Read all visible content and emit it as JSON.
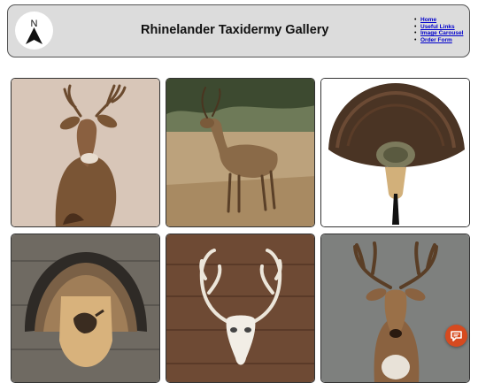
{
  "header": {
    "logo_letter": "N",
    "title": "Rhinelander Taxidermy Gallery",
    "nav": [
      {
        "label": "Home"
      },
      {
        "label": "Useful Links"
      },
      {
        "label": "Image Carousel"
      },
      {
        "label": "Order Form"
      }
    ]
  },
  "gallery": {
    "tiles": [
      {
        "subject": "whitetail deer shoulder mount"
      },
      {
        "subject": "whitetail buck standing in field"
      },
      {
        "subject": "turkey fan plaque mount"
      },
      {
        "subject": "turkey fan plaque with bird carving"
      },
      {
        "subject": "deer skull with antlers on wood"
      },
      {
        "subject": "whitetail buck mount on grey"
      }
    ]
  },
  "chat_widget": {
    "icon": "chat-icon",
    "color": "#d64a1f"
  }
}
